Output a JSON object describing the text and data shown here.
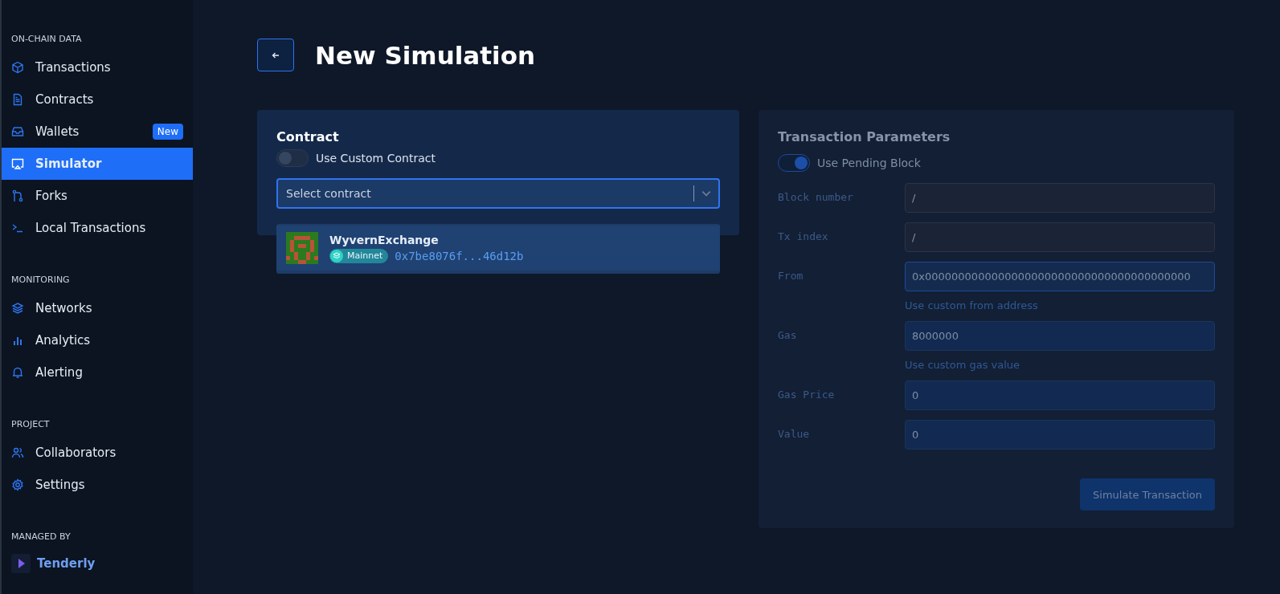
{
  "sidebar": {
    "sections": [
      {
        "heading": "ON-CHAIN DATA",
        "items": [
          {
            "label": "Transactions",
            "selected": false
          },
          {
            "label": "Contracts",
            "selected": false
          },
          {
            "label": "Wallets",
            "selected": false,
            "badge": "New"
          },
          {
            "label": "Simulator",
            "selected": true
          },
          {
            "label": "Forks",
            "selected": false
          },
          {
            "label": "Local Transactions",
            "selected": false
          }
        ]
      },
      {
        "heading": "MONITORING",
        "items": [
          {
            "label": "Networks",
            "selected": false
          },
          {
            "label": "Analytics",
            "selected": false
          },
          {
            "label": "Alerting",
            "selected": false
          }
        ]
      },
      {
        "heading": "PROJECT",
        "items": [
          {
            "label": "Collaborators",
            "selected": false
          },
          {
            "label": "Settings",
            "selected": false
          }
        ]
      }
    ],
    "footer": {
      "heading": "MANAGED BY",
      "brand": "Tenderly"
    }
  },
  "page": {
    "title": "New Simulation"
  },
  "contract": {
    "title": "Contract",
    "toggle": {
      "label": "Use Custom Contract",
      "on": false
    },
    "select": {
      "placeholder": "Select contract"
    },
    "options": [
      {
        "name": "WyvernExchange",
        "network": "Mainnet",
        "address": "0x7be8076f...46d12b"
      }
    ]
  },
  "parameters": {
    "title": "Transaction Parameters",
    "toggle": {
      "label": "Use Pending Block",
      "on": true
    },
    "fields": [
      {
        "label": "Block number",
        "value": "/",
        "disabled": true
      },
      {
        "label": "Tx index",
        "value": "/",
        "disabled": true
      },
      {
        "label": "From",
        "value": "0x0000000000000000000000000000000000000000",
        "disabled": false,
        "hint": "Use custom from address"
      },
      {
        "label": "Gas",
        "value": "8000000",
        "disabled": false,
        "hint": "Use custom gas value"
      },
      {
        "label": "Gas Price",
        "value": "0",
        "disabled": false
      },
      {
        "label": "Value",
        "value": "0",
        "disabled": false
      }
    ],
    "button": "Simulate Transaction"
  }
}
